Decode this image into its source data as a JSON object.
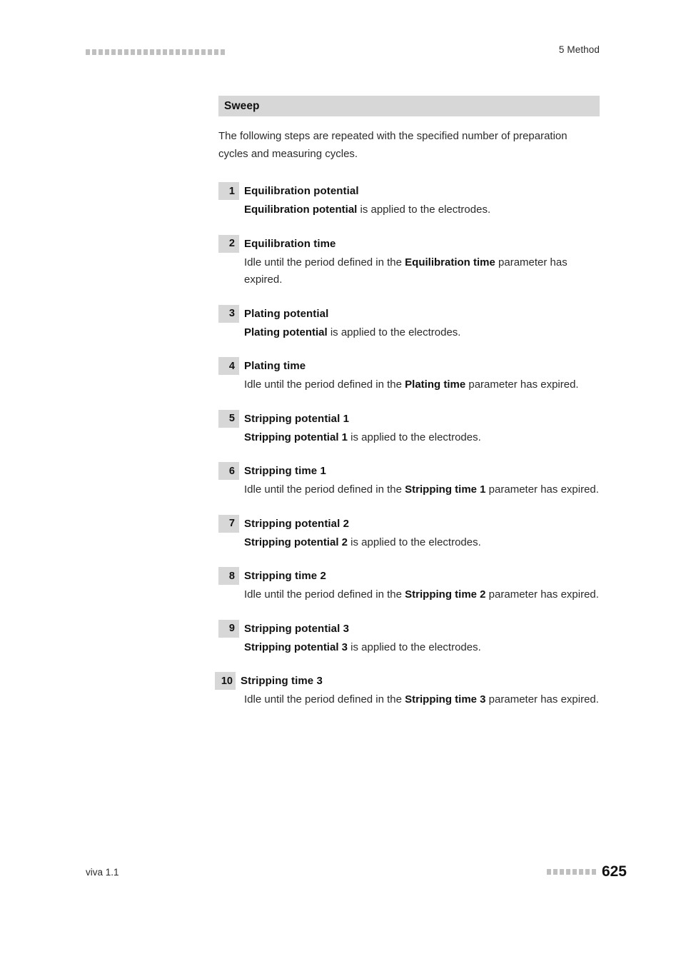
{
  "header": {
    "chapter": "5 Method",
    "decoration_squares": 22
  },
  "section": {
    "title": "Sweep",
    "intro": "The following steps are repeated with the specified number of preparation cycles and measuring cycles."
  },
  "steps": [
    {
      "number": "1",
      "title": "Equilibration potential",
      "desc_bold_lead": "Equilibration potential",
      "desc_rest": " is applied to the electrodes.",
      "desc_plain_lead": "",
      "desc_mid_bold": "",
      "desc_tail": ""
    },
    {
      "number": "2",
      "title": "Equilibration time",
      "desc_bold_lead": "",
      "desc_rest": "",
      "desc_plain_lead": "Idle until the period defined in the ",
      "desc_mid_bold": "Equilibration time",
      "desc_tail": " parameter has expired."
    },
    {
      "number": "3",
      "title": "Plating potential",
      "desc_bold_lead": "Plating potential",
      "desc_rest": " is applied to the electrodes.",
      "desc_plain_lead": "",
      "desc_mid_bold": "",
      "desc_tail": ""
    },
    {
      "number": "4",
      "title": "Plating time",
      "desc_bold_lead": "",
      "desc_rest": "",
      "desc_plain_lead": "Idle until the period defined in the ",
      "desc_mid_bold": "Plating time",
      "desc_tail": " parameter has expired."
    },
    {
      "number": "5",
      "title": "Stripping potential 1",
      "desc_bold_lead": "Stripping potential 1",
      "desc_rest": " is applied to the electrodes.",
      "desc_plain_lead": "",
      "desc_mid_bold": "",
      "desc_tail": ""
    },
    {
      "number": "6",
      "title": "Stripping time 1",
      "desc_bold_lead": "",
      "desc_rest": "",
      "desc_plain_lead": "Idle until the period defined in the ",
      "desc_mid_bold": "Stripping time 1",
      "desc_tail": " parameter has expired."
    },
    {
      "number": "7",
      "title": "Stripping potential 2",
      "desc_bold_lead": "Stripping potential 2",
      "desc_rest": " is applied to the electrodes.",
      "desc_plain_lead": "",
      "desc_mid_bold": "",
      "desc_tail": ""
    },
    {
      "number": "8",
      "title": "Stripping time 2",
      "desc_bold_lead": "",
      "desc_rest": "",
      "desc_plain_lead": "Idle until the period defined in the ",
      "desc_mid_bold": "Stripping time 2",
      "desc_tail": " parameter has expired."
    },
    {
      "number": "9",
      "title": "Stripping potential 3",
      "desc_bold_lead": "Stripping potential 3",
      "desc_rest": " is applied to the electrodes.",
      "desc_plain_lead": "",
      "desc_mid_bold": "",
      "desc_tail": ""
    },
    {
      "number": "10",
      "title": "Stripping time 3",
      "desc_bold_lead": "",
      "desc_rest": "",
      "desc_plain_lead": "Idle until the period defined in the ",
      "desc_mid_bold": "Stripping time 3",
      "desc_tail": " parameter has expired."
    }
  ],
  "footer": {
    "product": "viva 1.1",
    "page_number": "625",
    "decoration_squares": 8
  },
  "colors": {
    "band_gray": "#d7d7d7",
    "deco_gray": "#bfbfbf",
    "text": "#2b2b2b",
    "heading": "#111111",
    "background": "#ffffff"
  }
}
